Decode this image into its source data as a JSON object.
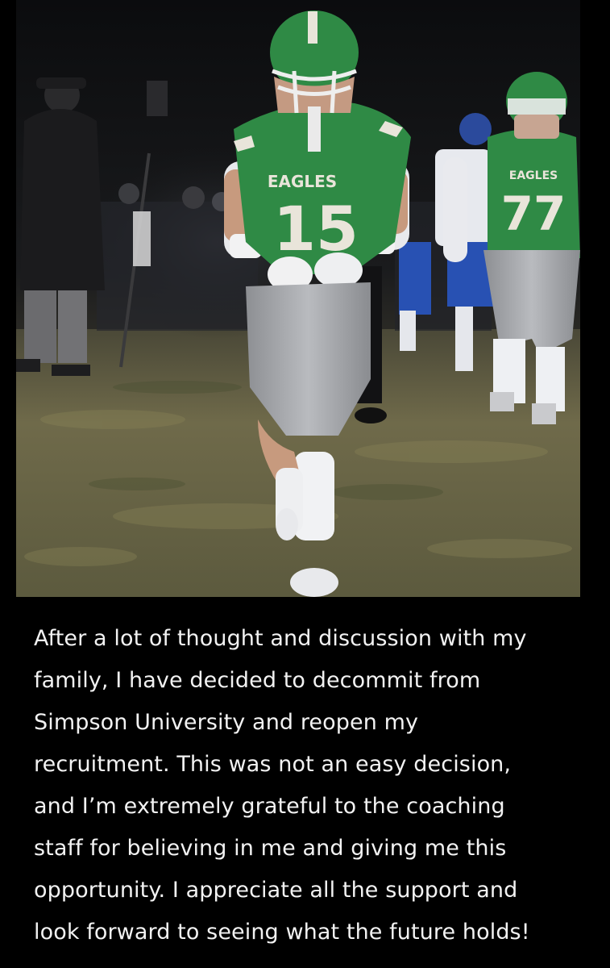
{
  "photo": {
    "jersey_team_main": "EAGLES",
    "jersey_number_main": "15",
    "jersey_team_background": "EAGLES",
    "jersey_number_background": "77",
    "jersey_color": "#2f8a45",
    "field_color": "#6f6a4a",
    "background_color": "#0d0e10"
  },
  "caption": {
    "lines": [
      "After a lot of thought and discussion with my",
      "family, I have decided to decommit from",
      "Simpson University and reopen my",
      "recruitment. This was not an easy decision,",
      "and I’m extremely grateful to the coaching",
      "staff for believing in me and giving me this",
      "opportunity. I appreciate all the support and",
      "look forward to seeing what the future holds!"
    ]
  }
}
